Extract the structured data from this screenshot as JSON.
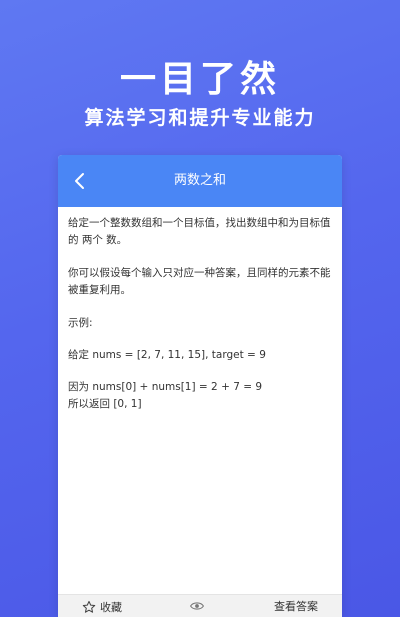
{
  "hero": {
    "title": "一目了然",
    "subtitle": "算法学习和提升专业能力"
  },
  "header": {
    "back_icon": "chevron-left-icon",
    "title": "两数之和"
  },
  "problem": {
    "description": "给定一个整数数组和一个目标值，找出数组中和为目标值的 两个 数。",
    "assumption": "你可以假设每个输入只对应一种答案，且同样的元素不能被重复利用。",
    "example_label": "示例:",
    "example_input": "给定 nums = [2, 7, 11, 15], target = 9",
    "example_explanation": "因为 nums[0] + nums[1] = 2 + 7 = 9",
    "example_output": "所以返回 [0, 1]"
  },
  "bottom_bar": {
    "favorite_label": "收藏",
    "favorite_icon": "star-outline-icon",
    "eye_icon": "eye-icon",
    "answer_label": "查看答案"
  },
  "colors": {
    "background": "#5466ee",
    "header": "#4a86f5",
    "text": "#333333"
  }
}
